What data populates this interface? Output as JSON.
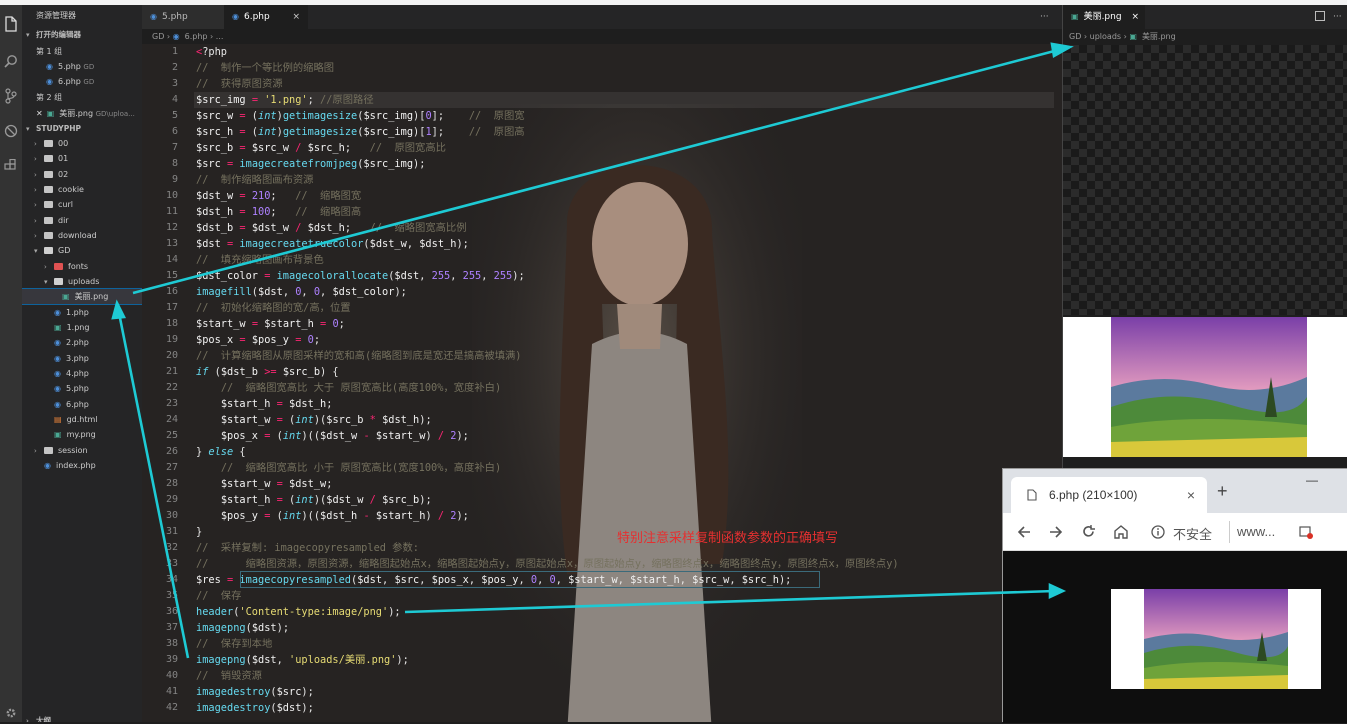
{
  "explorer": {
    "title": "资源管理器",
    "open_editors": "打开的编辑器",
    "group1": "第 1 组",
    "group1_files": [
      {
        "name": "5.php",
        "hint": "GD"
      },
      {
        "name": "6.php",
        "hint": "GD"
      }
    ],
    "group2": "第 2 组",
    "group2_file": {
      "name": "美丽.png",
      "hint": "GD\\uploa..."
    },
    "workspace": "STUDYPHP",
    "tree": {
      "f00": "00",
      "f01": "01",
      "f02": "02",
      "cookie": "cookie",
      "curl": "curl",
      "dir": "dir",
      "download": "download",
      "gd": "GD",
      "fonts": "fonts",
      "uploads": "uploads",
      "meili": "美丽.png",
      "p1": "1.php",
      "g1": "1.png",
      "p2": "2.php",
      "p3": "3.php",
      "p4": "4.php",
      "p5": "5.php",
      "p6": "6.php",
      "gdhtml": "gd.html",
      "mypng": "my.png",
      "session": "session",
      "index": "index.php"
    },
    "outline": "大纲"
  },
  "tabs": {
    "t1": "5.php",
    "t2": "6.php",
    "close": "×",
    "more": "···"
  },
  "breadcrumb": {
    "a": "GD",
    "b": "6.php",
    "c": "..."
  },
  "code": {
    "lines": [
      "<?php",
      "//  制作一个等比例的缩略图",
      "//  获得原图资源",
      "$src_img = '1.png'; //原图路径",
      "$src_w = (int)getimagesize($src_img)[0];    //  原图宽",
      "$src_h = (int)getimagesize($src_img)[1];    //  原图高",
      "$src_b = $src_w / $src_h;   //  原图宽高比",
      "$src = imagecreatefromjpeg($src_img);",
      "//  制作缩略图画布资源",
      "$dst_w = 210;   //  缩略图宽",
      "$dst_h = 100;   //  缩略图高",
      "$dst_b = $dst_w / $dst_h;   //  缩略图宽高比例",
      "$dst = imagecreatetruecolor($dst_w, $dst_h);",
      "//  填充缩略图画布背景色",
      "$dst_color = imagecolorallocate($dst, 255, 255, 255);",
      "imagefill($dst, 0, 0, $dst_color);",
      "//  初始化缩略图的宽/高，位置",
      "$start_w = $start_h = 0;",
      "$pos_x = $pos_y = 0;",
      "//  计算缩略图从原图采样的宽和高(缩略图到底是宽还是搞高被填满)",
      "if ($dst_b >= $src_b) {",
      "    //  缩略图宽高比 大于 原图宽高比(高度100%，宽度补白)",
      "    $start_h = $dst_h;",
      "    $start_w = (int)($src_b * $dst_h);",
      "    $pos_x = (int)(($dst_w - $start_w) / 2);",
      "} else {",
      "    //  缩略图宽高比 小于 原图宽高比(宽度100%，高度补白)",
      "    $start_w = $dst_w;",
      "    $start_h = (int)($dst_w / $src_b);",
      "    $pos_y = (int)(($dst_h - $start_h) / 2);",
      "}",
      "//  采样复制: imagecopyresampled 参数:",
      "//      缩略图资源，原图资源，缩略图起始点x，缩略图起始点y，原图起始点x，原图起始点y，缩略图终点x，缩略图终点y，原图终点x，原图终点y)",
      "$res = imagecopyresampled($dst, $src, $pos_x, $pos_y, 0, 0, $start_w, $start_h, $src_w, $src_h);",
      "//  保存",
      "header('Content-type:image/png');",
      "imagepng($dst);",
      "//  保存到本地",
      "imagepng($dst, 'uploads/美丽.png');",
      "//  销毁资源",
      "imagedestroy($src);",
      "imagedestroy($dst);"
    ]
  },
  "annotation": "特别注意采样复制函数参数的正确填写",
  "preview": {
    "tab": "美丽.png",
    "close": "×",
    "bread_a": "GD",
    "bread_b": "uploads",
    "bread_c": "美丽.png"
  },
  "browser": {
    "tab_title": "6.php (210×100)",
    "close": "×",
    "new_tab": "+",
    "minimize": "—",
    "insecure": "不安全",
    "url": "www..."
  },
  "colors": {
    "accent": "#007acc",
    "annotation": "#e53030",
    "arrow": "#1ecad4"
  }
}
